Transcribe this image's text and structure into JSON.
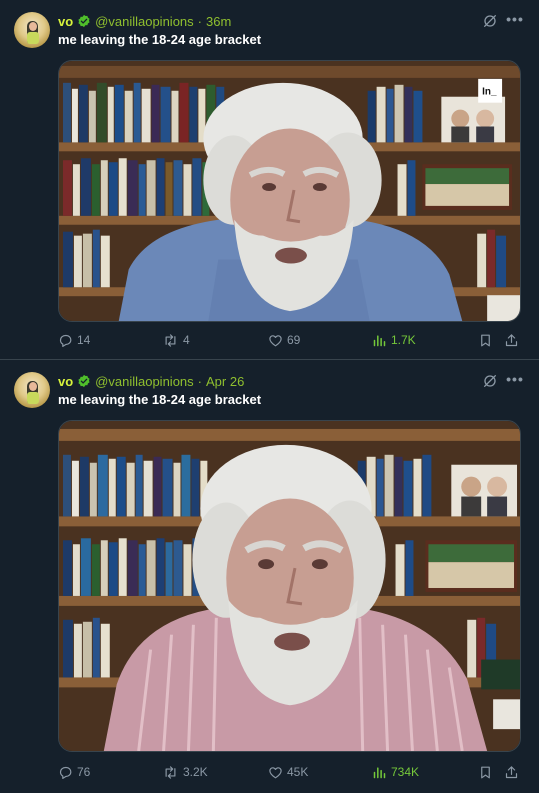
{
  "colors": {
    "background": "#15202b",
    "name_color": "#d7f23c",
    "handle_color": "#8fbf2f",
    "views_color": "#75c83a",
    "muted": "#8b98a5",
    "verified_badge": "#4fbf2b"
  },
  "tweets": [
    {
      "author_name": "vo",
      "handle": "@vanillaopinions",
      "separator": "·",
      "time": "36m",
      "text": "me leaving the 18-24 age bracket",
      "media_overlay_logo": "In_",
      "replies": "14",
      "reposts": "4",
      "likes": "69",
      "views": "1.7K",
      "icons": [
        "avatar",
        "verified-badge-icon",
        "grok-icon",
        "more-icon",
        "reply-icon",
        "repost-icon",
        "like-icon",
        "views-icon",
        "bookmark-icon",
        "share-icon"
      ]
    },
    {
      "author_name": "vo",
      "handle": "@vanillaopinions",
      "separator": "·",
      "time": "Apr 26",
      "text": "me leaving the 18-24 age bracket",
      "replies": "76",
      "reposts": "3.2K",
      "likes": "45K",
      "views": "734K",
      "icons": [
        "avatar",
        "verified-badge-icon",
        "grok-icon",
        "more-icon",
        "reply-icon",
        "repost-icon",
        "like-icon",
        "views-icon",
        "bookmark-icon",
        "share-icon"
      ]
    }
  ]
}
